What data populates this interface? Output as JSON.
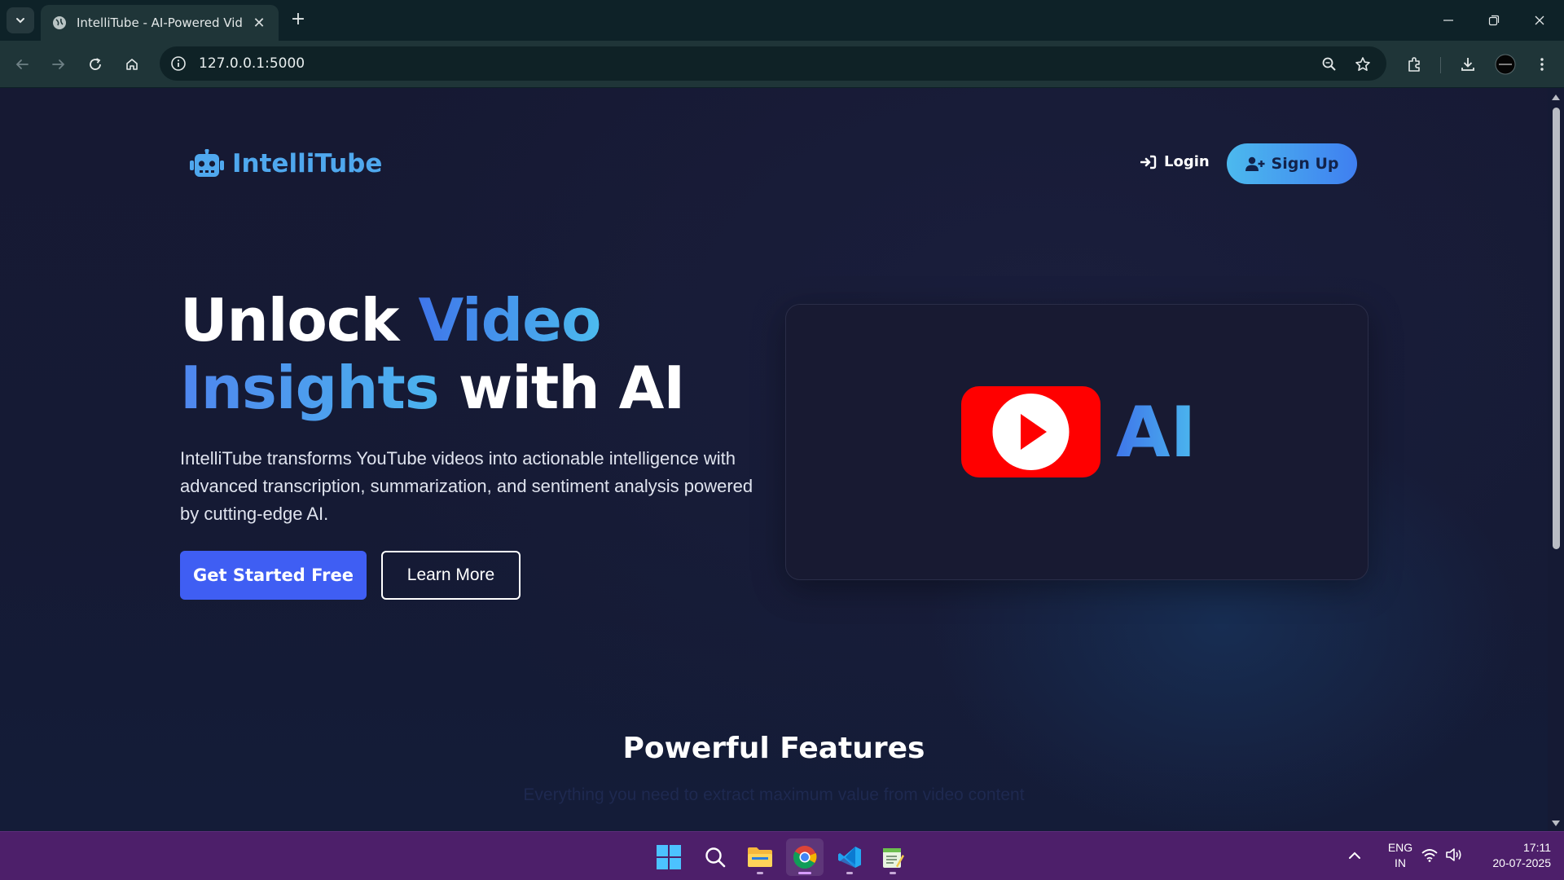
{
  "browser": {
    "tab_title": "IntelliTube - AI-Powered Video",
    "tab_close": "✕",
    "new_tab": "+",
    "url": "127.0.0.1:5000"
  },
  "site": {
    "brand": "IntelliTube",
    "nav": {
      "login": "Login",
      "signup": "Sign Up"
    }
  },
  "hero": {
    "title_w1": "Unlock ",
    "title_w2": "Video",
    "title_w3": "Insights",
    "title_w4": " with AI",
    "description": "IntelliTube transforms YouTube videos into actionable intelligence with advanced transcription, summarization, and sentiment analysis powered by cutting-edge AI.",
    "cta_primary": "Get Started Free",
    "cta_secondary": "Learn More",
    "card_ai_text": "AI"
  },
  "features": {
    "title": "Powerful Features",
    "subtitle": "Everything you need to extract maximum value from video content"
  },
  "taskbar": {
    "lang_line1": "ENG",
    "lang_line2": "IN",
    "time": "17:11",
    "date": "20-07-2025"
  },
  "colors": {
    "accent_blue": "#3f5ef3",
    "brand_cyan": "#4fa8ee",
    "youtube_red": "#ff0000",
    "taskbar_purple": "#4d1f6a"
  },
  "icons": [
    "tab-list-icon",
    "globe-icon",
    "back-icon",
    "forward-icon",
    "reload-icon",
    "home-icon",
    "site-info-icon",
    "zoom-icon",
    "bookmark-star-icon",
    "extensions-icon",
    "download-icon",
    "profile-avatar",
    "menu-icon",
    "robot-icon",
    "login-icon",
    "user-plus-icon",
    "youtube-play-icon",
    "windows-start-icon",
    "search-icon",
    "file-explorer-icon",
    "chrome-icon",
    "vscode-icon",
    "notepad-icon",
    "tray-chevron-icon",
    "wifi-icon",
    "volume-icon"
  ]
}
